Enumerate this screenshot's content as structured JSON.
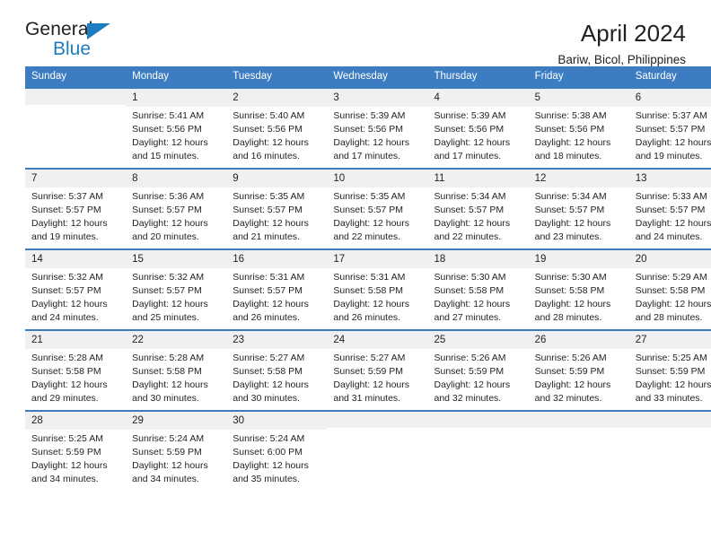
{
  "brand": {
    "name_top": "General",
    "name_bottom": "Blue",
    "triangle_icon": "triangle-icon",
    "color_blue": "#1c7cc0",
    "color_dark": "#231f20"
  },
  "header": {
    "title": "April 2024",
    "subtitle": "Bariw, Bicol, Philippines"
  },
  "theme": {
    "header_blue": "#3c7cc0",
    "daynum_gray": "#f0f0f0",
    "text_dark": "#231f20"
  },
  "weekdays": [
    "Sunday",
    "Monday",
    "Tuesday",
    "Wednesday",
    "Thursday",
    "Friday",
    "Saturday"
  ],
  "weeks": [
    [
      {
        "day": "",
        "blank": true
      },
      {
        "day": "1",
        "sunrise": "Sunrise: 5:41 AM",
        "sunset": "Sunset: 5:56 PM",
        "daylight1": "Daylight: 12 hours",
        "daylight2": "and 15 minutes."
      },
      {
        "day": "2",
        "sunrise": "Sunrise: 5:40 AM",
        "sunset": "Sunset: 5:56 PM",
        "daylight1": "Daylight: 12 hours",
        "daylight2": "and 16 minutes."
      },
      {
        "day": "3",
        "sunrise": "Sunrise: 5:39 AM",
        "sunset": "Sunset: 5:56 PM",
        "daylight1": "Daylight: 12 hours",
        "daylight2": "and 17 minutes."
      },
      {
        "day": "4",
        "sunrise": "Sunrise: 5:39 AM",
        "sunset": "Sunset: 5:56 PM",
        "daylight1": "Daylight: 12 hours",
        "daylight2": "and 17 minutes."
      },
      {
        "day": "5",
        "sunrise": "Sunrise: 5:38 AM",
        "sunset": "Sunset: 5:56 PM",
        "daylight1": "Daylight: 12 hours",
        "daylight2": "and 18 minutes."
      },
      {
        "day": "6",
        "sunrise": "Sunrise: 5:37 AM",
        "sunset": "Sunset: 5:57 PM",
        "daylight1": "Daylight: 12 hours",
        "daylight2": "and 19 minutes."
      }
    ],
    [
      {
        "day": "7",
        "sunrise": "Sunrise: 5:37 AM",
        "sunset": "Sunset: 5:57 PM",
        "daylight1": "Daylight: 12 hours",
        "daylight2": "and 19 minutes."
      },
      {
        "day": "8",
        "sunrise": "Sunrise: 5:36 AM",
        "sunset": "Sunset: 5:57 PM",
        "daylight1": "Daylight: 12 hours",
        "daylight2": "and 20 minutes."
      },
      {
        "day": "9",
        "sunrise": "Sunrise: 5:35 AM",
        "sunset": "Sunset: 5:57 PM",
        "daylight1": "Daylight: 12 hours",
        "daylight2": "and 21 minutes."
      },
      {
        "day": "10",
        "sunrise": "Sunrise: 5:35 AM",
        "sunset": "Sunset: 5:57 PM",
        "daylight1": "Daylight: 12 hours",
        "daylight2": "and 22 minutes."
      },
      {
        "day": "11",
        "sunrise": "Sunrise: 5:34 AM",
        "sunset": "Sunset: 5:57 PM",
        "daylight1": "Daylight: 12 hours",
        "daylight2": "and 22 minutes."
      },
      {
        "day": "12",
        "sunrise": "Sunrise: 5:34 AM",
        "sunset": "Sunset: 5:57 PM",
        "daylight1": "Daylight: 12 hours",
        "daylight2": "and 23 minutes."
      },
      {
        "day": "13",
        "sunrise": "Sunrise: 5:33 AM",
        "sunset": "Sunset: 5:57 PM",
        "daylight1": "Daylight: 12 hours",
        "daylight2": "and 24 minutes."
      }
    ],
    [
      {
        "day": "14",
        "sunrise": "Sunrise: 5:32 AM",
        "sunset": "Sunset: 5:57 PM",
        "daylight1": "Daylight: 12 hours",
        "daylight2": "and 24 minutes."
      },
      {
        "day": "15",
        "sunrise": "Sunrise: 5:32 AM",
        "sunset": "Sunset: 5:57 PM",
        "daylight1": "Daylight: 12 hours",
        "daylight2": "and 25 minutes."
      },
      {
        "day": "16",
        "sunrise": "Sunrise: 5:31 AM",
        "sunset": "Sunset: 5:57 PM",
        "daylight1": "Daylight: 12 hours",
        "daylight2": "and 26 minutes."
      },
      {
        "day": "17",
        "sunrise": "Sunrise: 5:31 AM",
        "sunset": "Sunset: 5:58 PM",
        "daylight1": "Daylight: 12 hours",
        "daylight2": "and 26 minutes."
      },
      {
        "day": "18",
        "sunrise": "Sunrise: 5:30 AM",
        "sunset": "Sunset: 5:58 PM",
        "daylight1": "Daylight: 12 hours",
        "daylight2": "and 27 minutes."
      },
      {
        "day": "19",
        "sunrise": "Sunrise: 5:30 AM",
        "sunset": "Sunset: 5:58 PM",
        "daylight1": "Daylight: 12 hours",
        "daylight2": "and 28 minutes."
      },
      {
        "day": "20",
        "sunrise": "Sunrise: 5:29 AM",
        "sunset": "Sunset: 5:58 PM",
        "daylight1": "Daylight: 12 hours",
        "daylight2": "and 28 minutes."
      }
    ],
    [
      {
        "day": "21",
        "sunrise": "Sunrise: 5:28 AM",
        "sunset": "Sunset: 5:58 PM",
        "daylight1": "Daylight: 12 hours",
        "daylight2": "and 29 minutes."
      },
      {
        "day": "22",
        "sunrise": "Sunrise: 5:28 AM",
        "sunset": "Sunset: 5:58 PM",
        "daylight1": "Daylight: 12 hours",
        "daylight2": "and 30 minutes."
      },
      {
        "day": "23",
        "sunrise": "Sunrise: 5:27 AM",
        "sunset": "Sunset: 5:58 PM",
        "daylight1": "Daylight: 12 hours",
        "daylight2": "and 30 minutes."
      },
      {
        "day": "24",
        "sunrise": "Sunrise: 5:27 AM",
        "sunset": "Sunset: 5:59 PM",
        "daylight1": "Daylight: 12 hours",
        "daylight2": "and 31 minutes."
      },
      {
        "day": "25",
        "sunrise": "Sunrise: 5:26 AM",
        "sunset": "Sunset: 5:59 PM",
        "daylight1": "Daylight: 12 hours",
        "daylight2": "and 32 minutes."
      },
      {
        "day": "26",
        "sunrise": "Sunrise: 5:26 AM",
        "sunset": "Sunset: 5:59 PM",
        "daylight1": "Daylight: 12 hours",
        "daylight2": "and 32 minutes."
      },
      {
        "day": "27",
        "sunrise": "Sunrise: 5:25 AM",
        "sunset": "Sunset: 5:59 PM",
        "daylight1": "Daylight: 12 hours",
        "daylight2": "and 33 minutes."
      }
    ],
    [
      {
        "day": "28",
        "sunrise": "Sunrise: 5:25 AM",
        "sunset": "Sunset: 5:59 PM",
        "daylight1": "Daylight: 12 hours",
        "daylight2": "and 34 minutes."
      },
      {
        "day": "29",
        "sunrise": "Sunrise: 5:24 AM",
        "sunset": "Sunset: 5:59 PM",
        "daylight1": "Daylight: 12 hours",
        "daylight2": "and 34 minutes."
      },
      {
        "day": "30",
        "sunrise": "Sunrise: 5:24 AM",
        "sunset": "Sunset: 6:00 PM",
        "daylight1": "Daylight: 12 hours",
        "daylight2": "and 35 minutes."
      },
      {
        "day": "",
        "blank": true
      },
      {
        "day": "",
        "blank": true
      },
      {
        "day": "",
        "blank": true
      },
      {
        "day": "",
        "blank": true
      }
    ]
  ]
}
